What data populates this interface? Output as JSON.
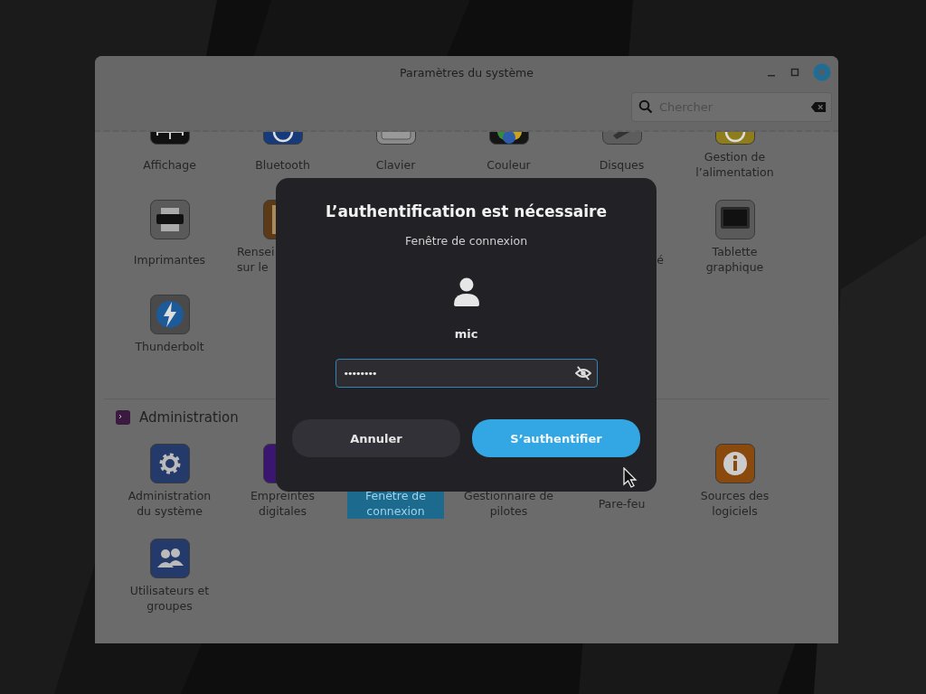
{
  "window": {
    "title": "Paramètres du système"
  },
  "search": {
    "placeholder": "Chercher"
  },
  "sections": [
    {
      "items": [
        {
          "label": "Affichage",
          "selected": false
        },
        {
          "label": "Bluetooth",
          "selected": false
        },
        {
          "label": "Clavier",
          "selected": false
        },
        {
          "label": "Couleur",
          "selected": false
        },
        {
          "label": "Disques",
          "selected": false
        },
        {
          "label": "Gestion de\nl’alimentation",
          "selected": false
        },
        {
          "label": "Imprimantes",
          "selected": false
        },
        {
          "label": "Rensei\nsur le",
          "selected": false
        },
        {
          "label": "é",
          "selected": false
        },
        {
          "label": "Tablette\ngraphique",
          "selected": false
        },
        {
          "label": "Thunderbolt",
          "selected": false
        }
      ]
    },
    {
      "title": "Administration",
      "items": [
        {
          "label": "Administration\ndu système",
          "selected": false
        },
        {
          "label": "Empreintes\ndigitales",
          "selected": false
        },
        {
          "label": "Fenêtre de\nconnexion",
          "selected": true
        },
        {
          "label": "Gestionnaire de\npilotes",
          "selected": false
        },
        {
          "label": "Pare-feu",
          "selected": false
        },
        {
          "label": "Sources des\nlogiciels",
          "selected": false
        },
        {
          "label": "Utilisateurs et\ngroupes",
          "selected": false
        }
      ]
    }
  ],
  "dialog": {
    "title": "L’authentification est nécessaire",
    "subtitle": "Fenêtre de connexion",
    "user": "mic",
    "password": "••••••••",
    "buttons": [
      {
        "label": "Annuler",
        "kind": "cancel"
      },
      {
        "label": "S’authentifier",
        "kind": "primary"
      }
    ]
  }
}
